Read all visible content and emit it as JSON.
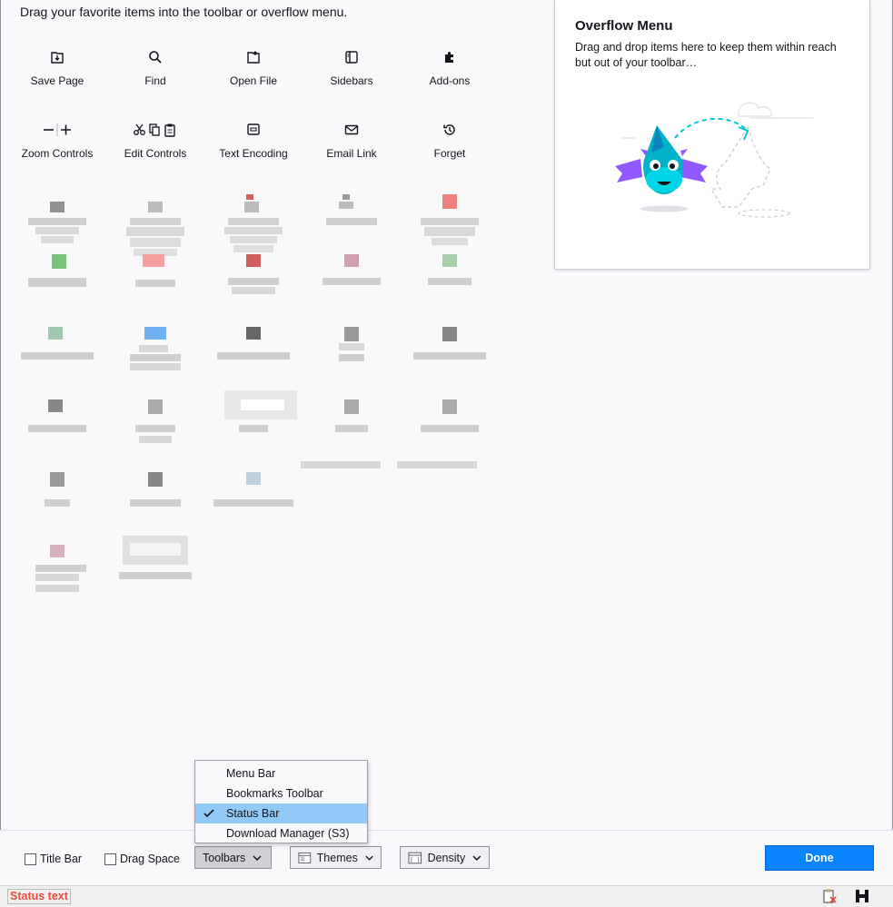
{
  "heading": "Drag your favorite items into the toolbar or overflow menu.",
  "palette_row1": [
    {
      "label": "Save Page",
      "icon": "save-page-icon"
    },
    {
      "label": "Find",
      "icon": "find-icon"
    },
    {
      "label": "Open File",
      "icon": "open-file-icon"
    },
    {
      "label": "Sidebars",
      "icon": "sidebars-icon"
    },
    {
      "label": "Add-ons",
      "icon": "add-ons-icon"
    }
  ],
  "palette_row2": [
    {
      "label": "Zoom Controls",
      "icon": "zoom-controls-icon"
    },
    {
      "label": "Edit Controls",
      "icon": "edit-controls-icon"
    },
    {
      "label": "Text Encoding",
      "icon": "text-encoding-icon"
    },
    {
      "label": "Email Link",
      "icon": "email-link-icon"
    },
    {
      "label": "Forget",
      "icon": "forget-icon"
    }
  ],
  "overflow": {
    "title": "Overflow Menu",
    "description": "Drag and drop items here to keep them within reach but out of your toolbar…"
  },
  "bottom": {
    "title_bar": "Title Bar",
    "drag_space": "Drag Space",
    "toolbars": "Toolbars",
    "themes": "Themes",
    "density": "Density",
    "done": "Done"
  },
  "toolbars_menu": [
    {
      "label": "Menu Bar",
      "checked": false
    },
    {
      "label": "Bookmarks Toolbar",
      "checked": false
    },
    {
      "label": "Status Bar",
      "checked": true
    },
    {
      "label": "Download Manager (S3)",
      "checked": false
    }
  ],
  "status_text": "Status text",
  "colors": {
    "accent": "#0a84ff",
    "menu_highlight": "#91c9f7",
    "status_text": "#e74c3c"
  }
}
